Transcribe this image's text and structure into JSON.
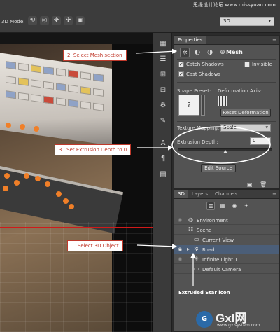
{
  "app": {
    "watermark": "思缘设计论坛 www.missyuan.com",
    "mode_label": "3D Mode:",
    "mode_icons": [
      "rotate-icon",
      "roll-icon",
      "pan-icon",
      "slide-icon",
      "scale-icon"
    ],
    "view_dropdown": "3D"
  },
  "callouts": {
    "step2": "2. Select Mesh section",
    "step3": "3.. Set Extrusion Depth to 0",
    "step1": "1. Select 3D Object",
    "star_icon_note": "Extruded Star icon"
  },
  "properties": {
    "tab_label": "Properties",
    "section_title": "Mesh",
    "catch_shadows": "Catch Shadows",
    "catch_shadows_checked": true,
    "invisible": "Invisible",
    "invisible_checked": false,
    "cast_shadows": "Cast Shadows",
    "cast_shadows_checked": true,
    "shape_preset_label": "Shape Preset:",
    "shape_preset_value": "?",
    "deformation_axis_label": "Deformation Axis:",
    "reset_deformation": "Reset Deformation",
    "texture_mapping_label": "Texture Mapping:",
    "texture_mapping_value": "Scale",
    "extrusion_depth_label": "Extrusion Depth:",
    "extrusion_depth_value": "0",
    "edit_source": "Edit Source"
  },
  "scene_panel": {
    "tabs": [
      "3D",
      "Layers",
      "Channels"
    ],
    "active_tab": "3D",
    "items": [
      {
        "name": "Environment",
        "icon": "globe-icon"
      },
      {
        "name": "Scene",
        "icon": "scene-icon"
      },
      {
        "name": "Current View",
        "icon": "camera-icon"
      },
      {
        "name": "Road",
        "icon": "mesh-star-icon"
      },
      {
        "name": "Infinite Light 1",
        "icon": "light-icon"
      },
      {
        "name": "Default Camera",
        "icon": "camera-icon"
      }
    ],
    "selected_item": "Road"
  },
  "site_watermark": {
    "logo": "G",
    "text": "Gxl网",
    "sub": "www.gxlsystem.com"
  },
  "colors": {
    "callout_border": "#c0392b",
    "highlight_row": "#4b5e78",
    "dots": "#f07f28",
    "floor_line": "#d01a1a"
  }
}
